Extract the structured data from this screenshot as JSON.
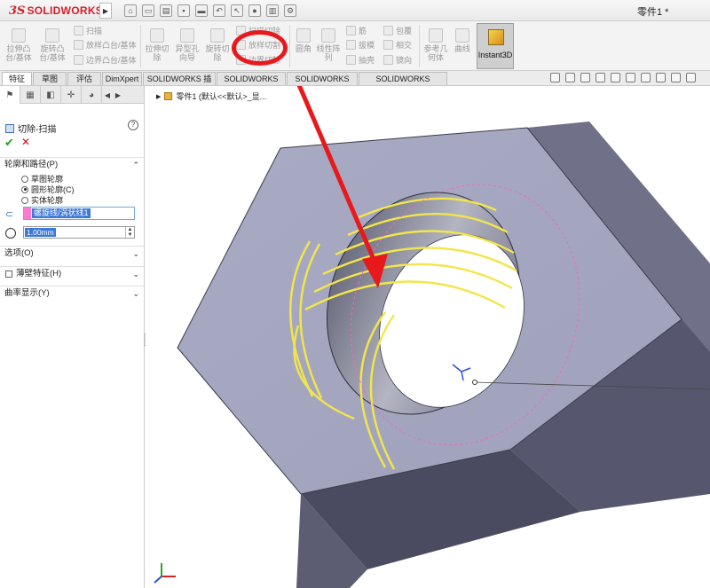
{
  "app": {
    "logo_ds": "3S",
    "logo_name": "SOLIDWORKS",
    "document_title": "零件1 *"
  },
  "command_manager": {
    "extrude_boss": "拉伸凸\n台/基体",
    "revolve_boss": "旋转凸\n台/基体",
    "sweep": "扫描",
    "loft_boss": "放样凸台/基体",
    "boundary_boss": "边界凸台/基体",
    "extrude_cut": "拉伸切\n除",
    "hole_wizard": "异型孔\n向导",
    "revolve_cut": "旋转切\n除",
    "swept_cut": "扫描切除",
    "lofted_cut": "放样切割",
    "boundary_cut": "边界切除",
    "fillet": "圆角",
    "linear_pattern": "线性阵\n列",
    "rib": "筋",
    "draft": "拔模",
    "shell": "抽壳",
    "wrap": "包覆",
    "intersect": "相交",
    "mirror": "镜向",
    "reference_geometry": "参考几\n何体",
    "curves": "曲线",
    "instant3d": "Instant3D"
  },
  "tabs": [
    {
      "label": "特征",
      "active": true
    },
    {
      "label": "草图",
      "active": false
    },
    {
      "label": "评估",
      "active": false
    },
    {
      "label": "DimXpert",
      "active": false
    },
    {
      "label": "SOLIDWORKS 插件",
      "active": false
    },
    {
      "label": "SOLIDWORKS MBD",
      "active": false
    },
    {
      "label": "SOLIDWORKS CAM",
      "active": false
    },
    {
      "label": "SOLIDWORKS Inspection",
      "active": false
    }
  ],
  "property_manager": {
    "title": "切除-扫描",
    "help": "?",
    "ok": "✔",
    "cancel": "✕",
    "profile_group": "轮廓和路径(P)",
    "radio_sketch": "草图轮廓",
    "radio_circle": "圆形轮廓(C)",
    "radio_solid": "实体轮廓",
    "selected_radio": "circle",
    "path_value": "螺旋线/涡状线1",
    "diameter_value": "1.00mm",
    "options_group": "选项(O)",
    "thin_group": "薄壁特征(H)",
    "curvature_group": "曲率显示(Y)"
  },
  "viewport": {
    "tree_label": "零件1  (默认<<默认>_显..."
  },
  "colors": {
    "accent_red": "#e8191c",
    "selection_blue": "#3c78d8",
    "thread_yellow": "#f2e64a",
    "nut_top": "#a7a9c2",
    "nut_side": "#4f5067"
  },
  "icons": {
    "path": "helix-path-icon",
    "diameter": "diameter-icon",
    "instant3d": "instant3d-icon"
  }
}
